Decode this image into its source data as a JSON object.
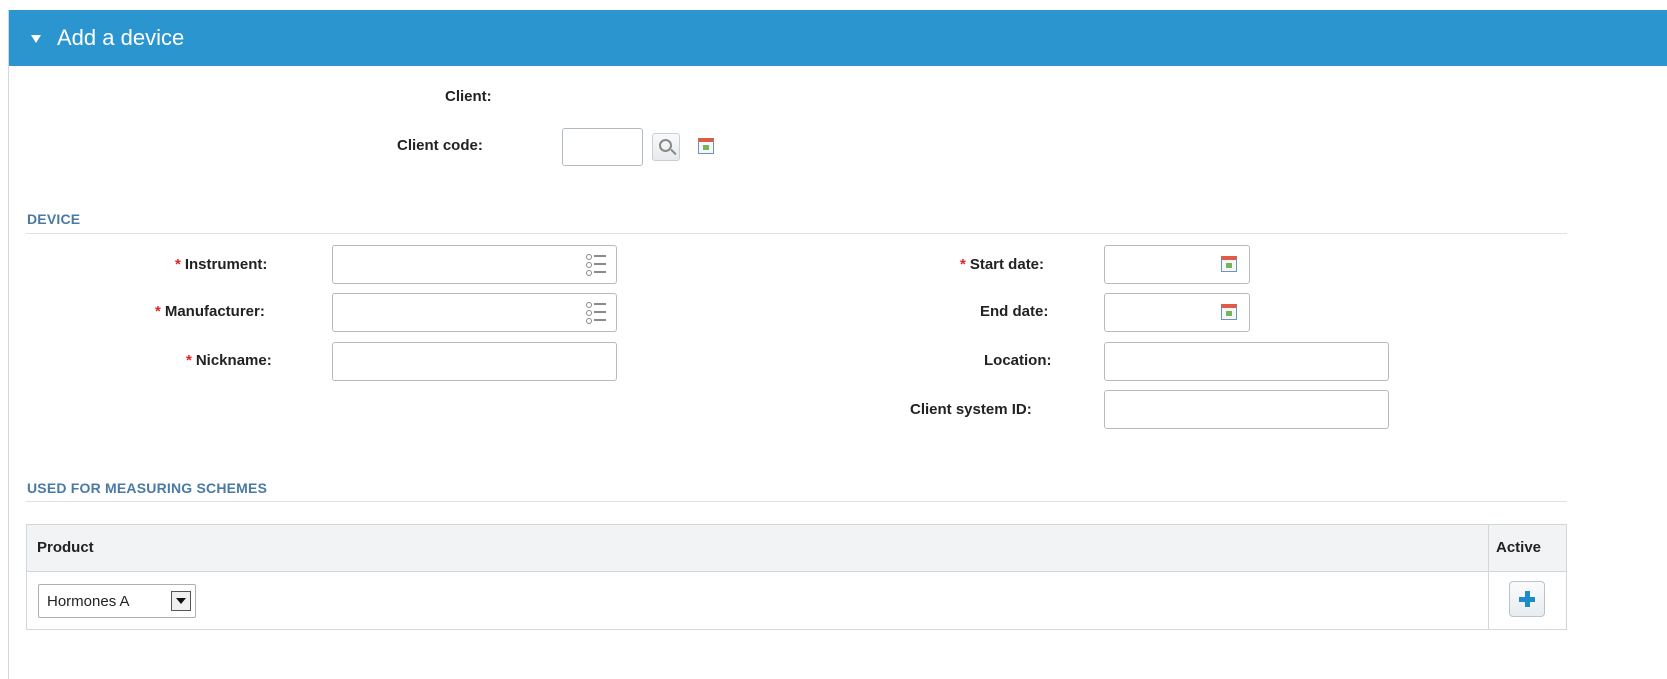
{
  "panel": {
    "title": "Add a device"
  },
  "client": {
    "client_label": "Client:",
    "client_code_label": "Client code:",
    "client_code_value": ""
  },
  "device_section": {
    "title": "DEVICE",
    "instrument_label": "Instrument:",
    "manufacturer_label": "Manufacturer:",
    "nickname_label": "Nickname:",
    "start_date_label": "Start date:",
    "end_date_label": "End date:",
    "location_label": "Location:",
    "client_system_id_label": "Client system ID:",
    "required_marker": "*"
  },
  "schemes_section": {
    "title": "USED FOR MEASURING SCHEMES",
    "columns": {
      "product": "Product",
      "active": "Active"
    },
    "rows": [
      {
        "product": "Hormones A"
      }
    ]
  },
  "icons": {
    "panel_toggle": "triangle-down-icon",
    "search": "search-icon",
    "calendar": "calendar-icon",
    "list": "list-icon",
    "add": "plus-icon",
    "dropdown": "dropdown-arrow-icon"
  },
  "colors": {
    "header_bg": "#2b95cf",
    "section_title": "#4a79a5",
    "required": "#dd2222",
    "add_icon": "#1e8bc8"
  }
}
